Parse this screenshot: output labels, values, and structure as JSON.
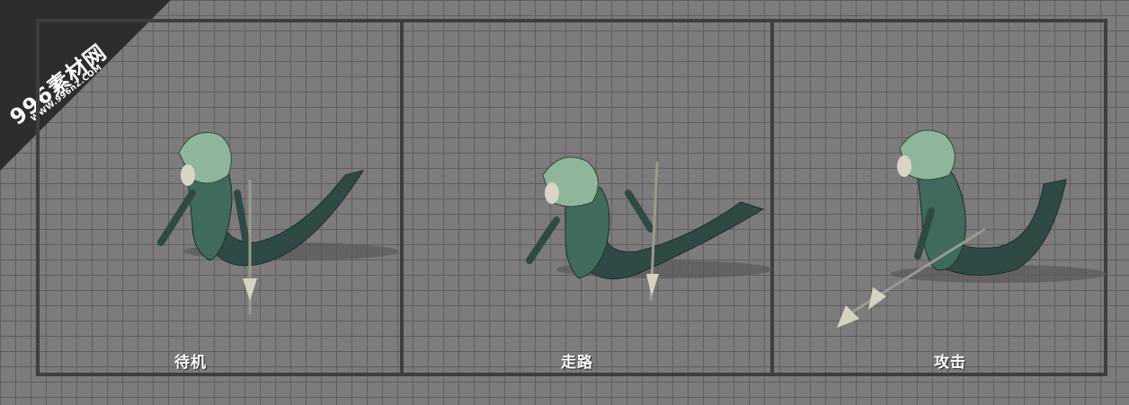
{
  "watermark": {
    "title": "996素材网",
    "url": "WWW.996n2.COM"
  },
  "panels": [
    {
      "label": "待机"
    },
    {
      "label": "走路"
    },
    {
      "label": "攻击"
    }
  ],
  "colors": {
    "background": "#7d7b7c",
    "grid": "#5f5d5e",
    "frame": "#3f3e3f",
    "creature_body": "#2f4a44",
    "creature_mane": "#8fb59a"
  }
}
